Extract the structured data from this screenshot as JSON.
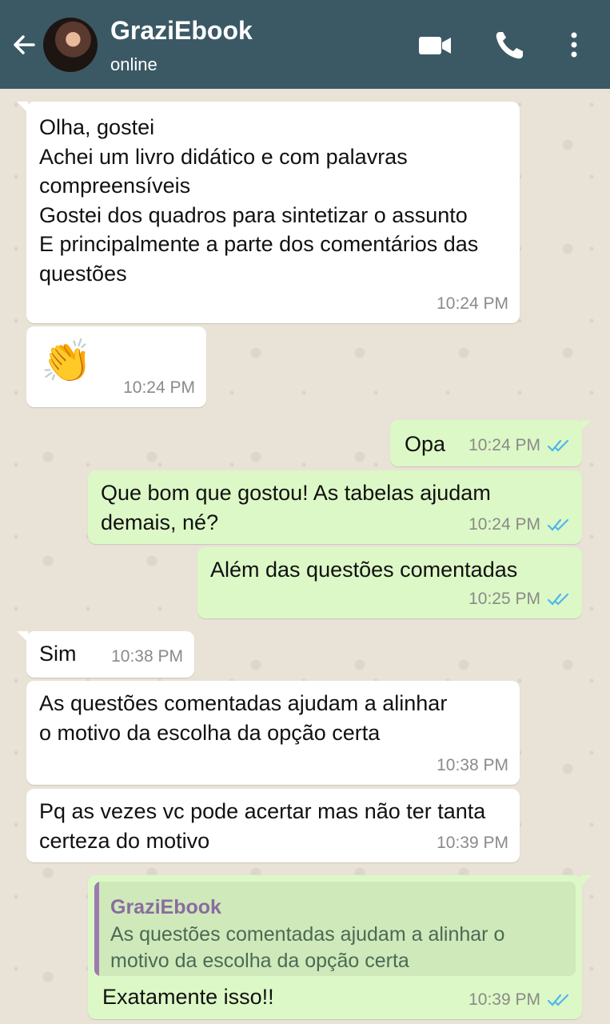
{
  "header": {
    "contact_name": "GraziEbook",
    "status": "online",
    "icons": [
      "back-arrow-icon",
      "video-call-icon",
      "phone-icon",
      "more-options-icon"
    ]
  },
  "messages": [
    {
      "direction": "incoming",
      "text": "Olha, gostei\nAchei um livro didático e com palavras compreensíveis\nGostei dos quadros para sintetizar o assunto\nE principalmente a parte dos comentários das questões",
      "time": "10:24 PM"
    },
    {
      "direction": "incoming",
      "emoji": "👏",
      "time": "10:24 PM"
    },
    {
      "direction": "outgoing",
      "text": "Opa",
      "time": "10:24 PM",
      "status": "read"
    },
    {
      "direction": "outgoing",
      "text": "Que bom que gostou! As tabelas ajudam demais, né?",
      "time": "10:24 PM",
      "status": "read"
    },
    {
      "direction": "outgoing",
      "text": "Além das questões comentadas",
      "time": "10:25 PM",
      "status": "read"
    },
    {
      "direction": "incoming",
      "text": "Sim",
      "time": "10:38 PM"
    },
    {
      "direction": "incoming",
      "text": "As questões comentadas ajudam a alinhar o motivo da escolha da opção certa",
      "time": "10:38 PM"
    },
    {
      "direction": "incoming",
      "text": "Pq as vezes vc pode acertar mas não ter tanta certeza do motivo",
      "time": "10:39 PM"
    },
    {
      "direction": "outgoing",
      "reply_to": {
        "author": "GraziEbook",
        "text": "As questões comentadas ajudam a alinhar o motivo da escolha da opção certa"
      },
      "text": "Exatamente isso!!",
      "time": "10:39 PM",
      "status": "read"
    }
  ],
  "colors": {
    "header_bg": "#3b5965",
    "chat_bg": "#e9e2d6",
    "incoming_bubble": "#ffffff",
    "outgoing_bubble": "#dcf8c6",
    "read_ticks": "#4fb6ec",
    "quote_author": "#8a6ca0"
  }
}
